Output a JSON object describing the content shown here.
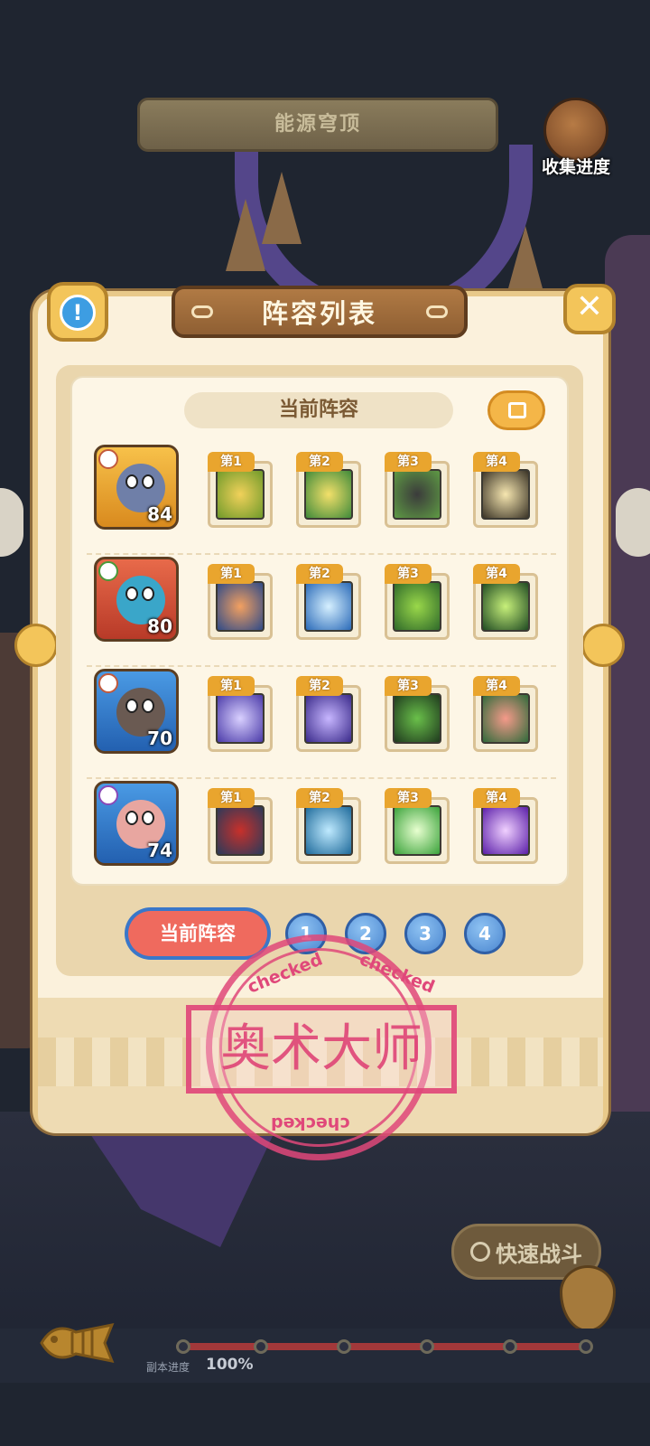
{
  "scene": {
    "banner_title": "能源穹顶",
    "collect_label": "收集进度",
    "quick_battle_label": "快速战斗",
    "progress_label": "副本进度",
    "progress_value": "100%",
    "progress_fraction": 1.0
  },
  "panel": {
    "title": "阵容列表",
    "header": "当前阵容",
    "tabs": [
      "当前阵容",
      "1",
      "2",
      "3",
      "4"
    ],
    "selected_tab": "当前阵容"
  },
  "team": [
    {
      "level": "84",
      "skills": [
        "第1",
        "第2",
        "第3",
        "第4"
      ]
    },
    {
      "level": "80",
      "skills": [
        "第1",
        "第2",
        "第3",
        "第4"
      ]
    },
    {
      "level": "70",
      "skills": [
        "第1",
        "第2",
        "第3",
        "第4"
      ]
    },
    {
      "level": "74",
      "skills": [
        "第1",
        "第2",
        "第3",
        "第4"
      ]
    }
  ],
  "stamp": {
    "center_text": "奥术大师",
    "ring_text": "checked"
  },
  "colors": {
    "panel_bg": "#fbf1dc",
    "accent_gold": "#f3c55a",
    "tab_selected": "#ef6a5e",
    "tab_number": "#4a86d0",
    "stamp": "#e0487a"
  }
}
